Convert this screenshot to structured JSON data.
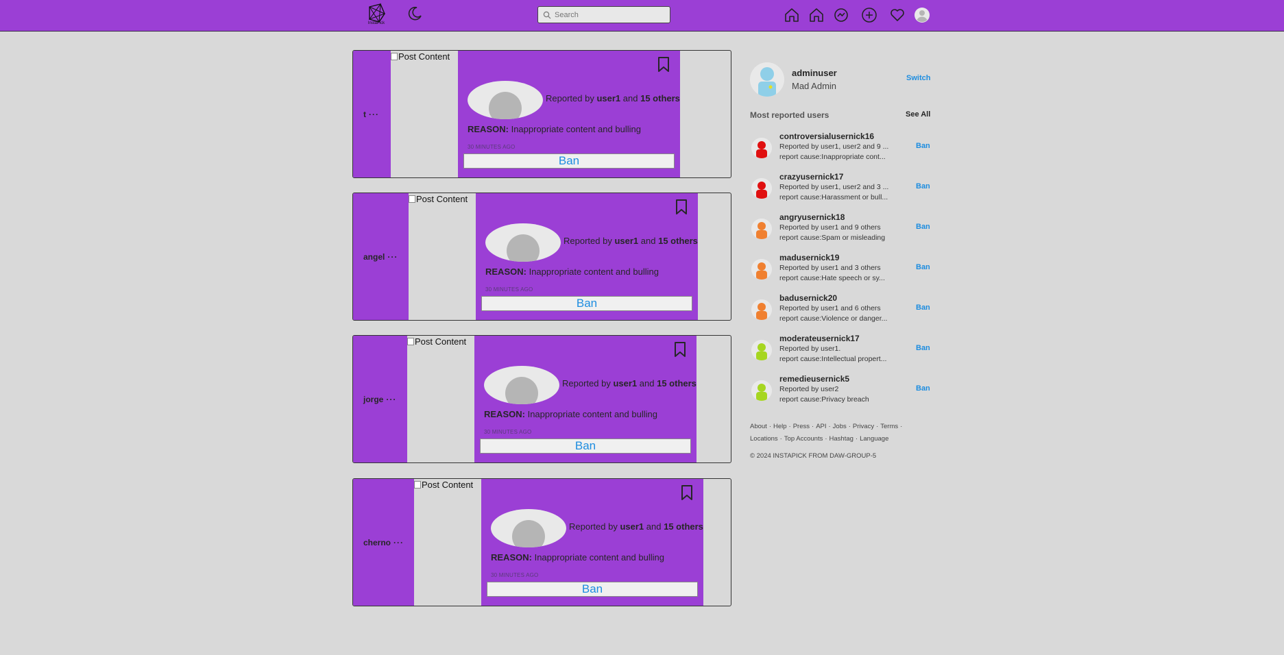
{
  "app": {
    "logo_text": "InstaPick"
  },
  "search": {
    "placeholder": "Search"
  },
  "nav": {
    "icons": [
      "moon-icon",
      "home-icon",
      "home-outline-icon",
      "messenger-icon",
      "add-icon",
      "heart-icon",
      "profile-avatar-icon"
    ]
  },
  "colors": {
    "brand": "#9b3fd5",
    "link": "#1d8de0",
    "background": "#d9d9d9"
  },
  "posts": [
    {
      "username": "t",
      "dots": "···",
      "image_alt": "Post Content",
      "reported_prefix": "Reported by",
      "reporter": "user1",
      "and": "and",
      "others": "15 others",
      "reason_label": "REASON:",
      "reason": "Inappropriate content and bulling",
      "time": "30 MINUTES AGO",
      "ban_label": "Ban"
    },
    {
      "username": "angel",
      "dots": "···",
      "image_alt": "Post Content",
      "reported_prefix": "Reported by",
      "reporter": "user1",
      "and": "and",
      "others": "15 others",
      "reason_label": "REASON:",
      "reason": "Inappropriate content and bulling",
      "time": "30 MINUTES AGO",
      "ban_label": "Ban"
    },
    {
      "username": "jorge",
      "dots": "···",
      "image_alt": "Post Content",
      "reported_prefix": "Reported by",
      "reporter": "user1",
      "and": "and",
      "others": "15 others",
      "reason_label": "REASON:",
      "reason": "Inappropriate content and bulling",
      "time": "30 MINUTES AGO",
      "ban_label": "Ban"
    },
    {
      "username": "cherno",
      "dots": "···",
      "image_alt": "Post Content",
      "reported_prefix": "Reported by",
      "reporter": "user1",
      "and": "and",
      "others": "15 others",
      "reason_label": "REASON:",
      "reason": "Inappropriate content and bulling",
      "time": "30 MINUTES AGO",
      "ban_label": "Ban"
    }
  ],
  "profile": {
    "username": "adminuser",
    "subtitle": "Mad Admin",
    "switch_label": "Switch"
  },
  "reported_section": {
    "title": "Most reported users",
    "see_all": "See All"
  },
  "reported_users": [
    {
      "name": "controversialusernick16",
      "line1": "Reported by user1, user2 and 9 ...",
      "line2": "report cause:Inappropriate cont...",
      "ban": "Ban",
      "avatar_color": "#e01010"
    },
    {
      "name": "crazyusernick17",
      "line1": "Reported by user1, user2 and 3 ...",
      "line2": "report cause:Harassment or bull...",
      "ban": "Ban",
      "avatar_color": "#e01010"
    },
    {
      "name": "angryusernick18",
      "line1": "Reported by user1 and 9 others",
      "line2": "report cause:Spam or misleading",
      "ban": "Ban",
      "avatar_color": "#f08030"
    },
    {
      "name": "madusernick19",
      "line1": "Reported by user1 and 3 others",
      "line2": "report cause:Hate speech or sy...",
      "ban": "Ban",
      "avatar_color": "#f08030"
    },
    {
      "name": "badusernick20",
      "line1": "Reported by user1 and 6 others",
      "line2": "report cause:Violence or danger...",
      "ban": "Ban",
      "avatar_color": "#f08030"
    },
    {
      "name": "moderateusernick17",
      "line1": "Reported by user1.",
      "line2": "report cause:Intellectual propert...",
      "ban": "Ban",
      "avatar_color": "#a6d620"
    },
    {
      "name": "remedieusernick5",
      "line1": "Reported by user2",
      "line2": "report cause:Privacy breach",
      "ban": "Ban",
      "avatar_color": "#a6d620"
    }
  ],
  "footer": {
    "links_row1": [
      "About",
      "Help",
      "Press",
      "API",
      "Jobs",
      "Privacy",
      "Terms"
    ],
    "links_row2": [
      "Locations",
      "Top Accounts",
      "Hashtag",
      "Language"
    ],
    "copyright": "© 2024 INSTAPICK FROM DAW-GROUP-5"
  }
}
